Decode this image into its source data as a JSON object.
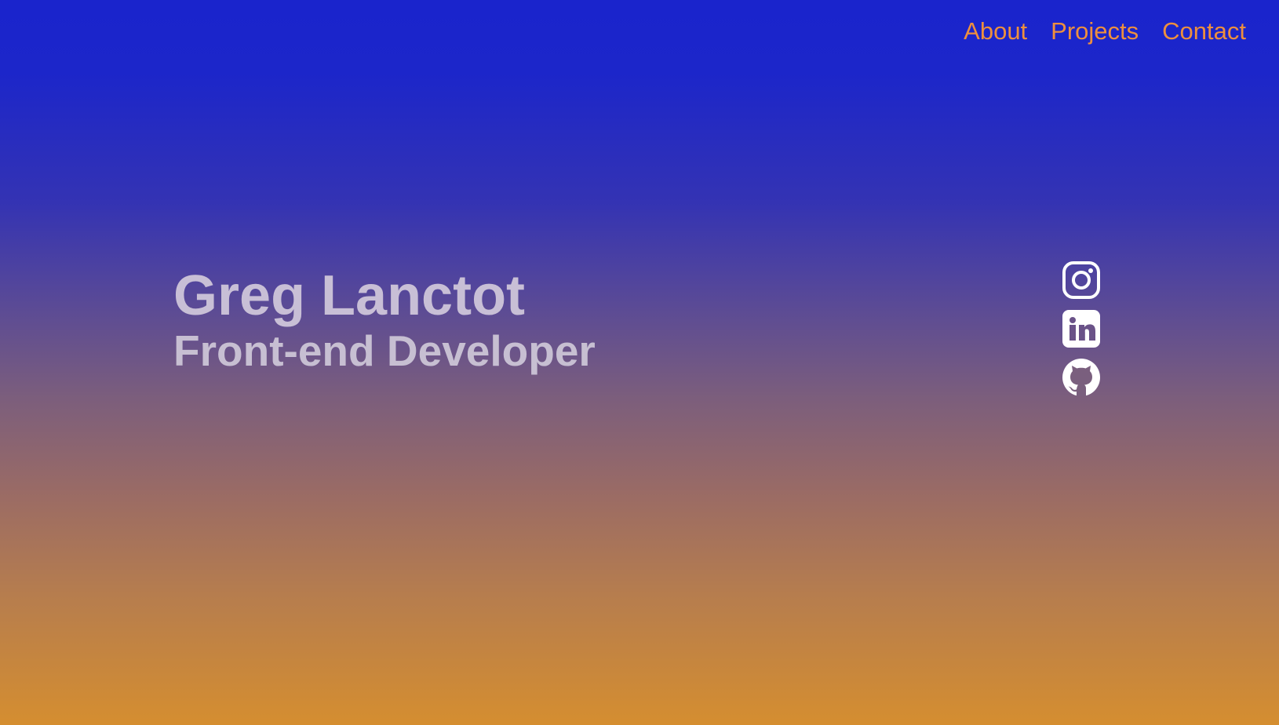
{
  "nav": {
    "items": [
      {
        "label": "About"
      },
      {
        "label": "Projects"
      },
      {
        "label": "Contact"
      }
    ],
    "color": "#ed8f3e"
  },
  "hero": {
    "name": "Greg Lanctot",
    "role": "Front-end Developer",
    "text_color": "#c8bfd6"
  },
  "social": {
    "icons": [
      "instagram-icon",
      "linkedin-icon",
      "github-icon"
    ],
    "color": "#ffffff"
  },
  "background": {
    "gradient_top": "#1a24cc",
    "gradient_bottom": "#d58e30"
  }
}
